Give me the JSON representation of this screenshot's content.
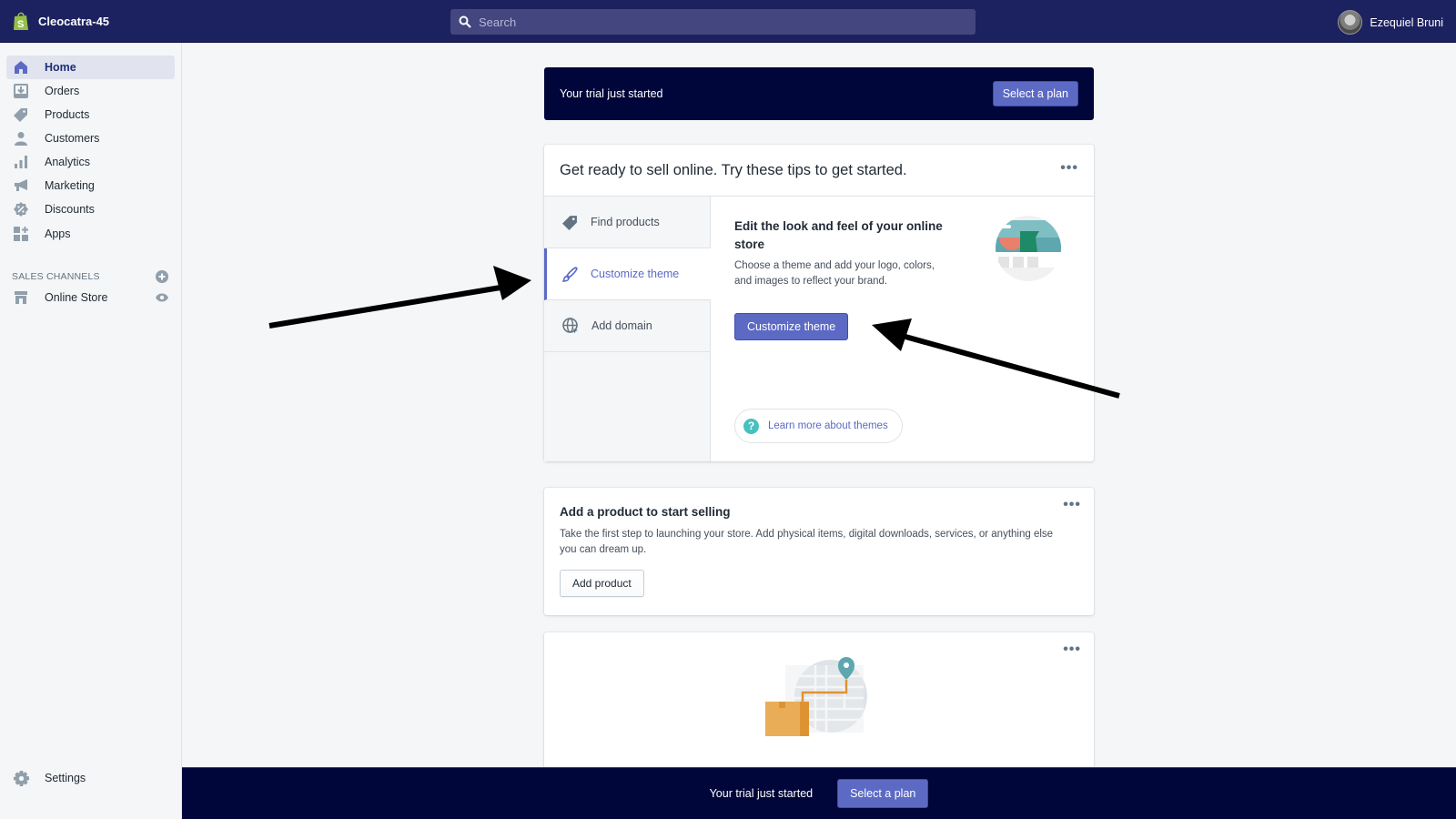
{
  "topbar": {
    "store_name": "Cleocatra-45",
    "search_placeholder": "Search",
    "user_name": "Ezequiel Bruni"
  },
  "sidebar": {
    "items": [
      {
        "label": "Home",
        "icon": "home-icon",
        "active": true
      },
      {
        "label": "Orders",
        "icon": "orders-icon"
      },
      {
        "label": "Products",
        "icon": "tag-icon"
      },
      {
        "label": "Customers",
        "icon": "person-icon"
      },
      {
        "label": "Analytics",
        "icon": "bar-chart-icon"
      },
      {
        "label": "Marketing",
        "icon": "megaphone-icon"
      },
      {
        "label": "Discounts",
        "icon": "discount-icon"
      },
      {
        "label": "Apps",
        "icon": "apps-icon"
      }
    ],
    "sales_channels_header": "SALES CHANNELS",
    "channels": [
      {
        "label": "Online Store",
        "icon": "store-icon"
      }
    ],
    "settings_label": "Settings"
  },
  "banner": {
    "text": "Your trial just started",
    "button": "Select a plan"
  },
  "tips": {
    "title": "Get ready to sell online. Try these tips to get started.",
    "tabs": [
      {
        "label": "Find products",
        "icon": "tag-icon"
      },
      {
        "label": "Customize theme",
        "icon": "brush-icon",
        "active": true
      },
      {
        "label": "Add domain",
        "icon": "globe-icon"
      }
    ],
    "heading": "Edit the look and feel of your online store",
    "description": "Choose a theme and add your logo, colors, and images to reflect your brand.",
    "button": "Customize theme",
    "learn_more": "Learn more about themes"
  },
  "product_card": {
    "title": "Add a product to start selling",
    "description": "Take the first step to launching your store. Add physical items, digital downloads, services, or anything else you can dream up.",
    "button": "Add product"
  },
  "bottom_bar": {
    "text": "Your trial just started",
    "button": "Select a plan"
  },
  "colors": {
    "topbar": "#1c2260",
    "banner": "#000639",
    "primary": "#5c6ac4",
    "teal": "#47c1bf"
  }
}
